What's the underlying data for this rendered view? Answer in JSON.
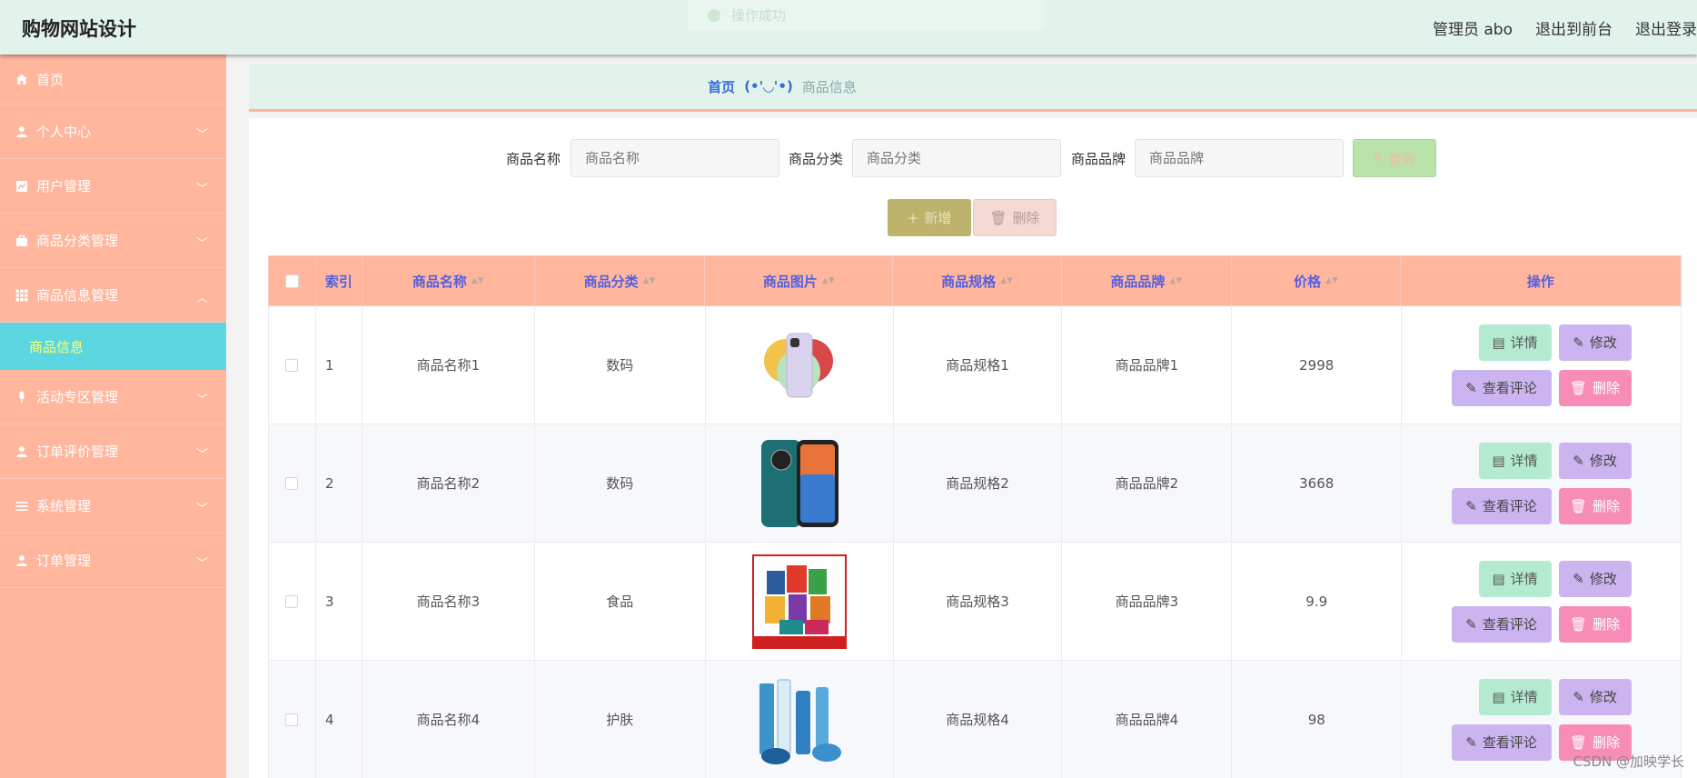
{
  "header": {
    "brand": "购物网站设计",
    "admin": "管理员 abo",
    "front": "退出到前台",
    "logout": "退出登录"
  },
  "toast": "操作成功",
  "sidebar": {
    "items": [
      {
        "label": "首页",
        "icon": "home-icon"
      },
      {
        "label": "个人中心",
        "icon": "user-icon"
      },
      {
        "label": "用户管理",
        "icon": "chart-icon"
      },
      {
        "label": "商品分类管理",
        "icon": "briefcase-icon"
      },
      {
        "label": "商品信息管理",
        "icon": "grid-icon"
      },
      {
        "label": "活动专区管理",
        "icon": "mic-icon"
      },
      {
        "label": "订单评价管理",
        "icon": "user-icon"
      },
      {
        "label": "系统管理",
        "icon": "list-icon"
      },
      {
        "label": "订单管理",
        "icon": "user-icon"
      }
    ],
    "sub_active": "商品信息"
  },
  "breadcrumb": {
    "home": "首页",
    "sep": "(•'◡'•)",
    "current": "商品信息"
  },
  "search": {
    "name_label": "商品名称",
    "name_placeholder": "商品名称",
    "category_label": "商品分类",
    "category_placeholder": "商品分类",
    "brand_label": "商品品牌",
    "brand_placeholder": "商品品牌",
    "query": "查询"
  },
  "actions": {
    "add": "新增",
    "delete": "删除"
  },
  "table": {
    "headers": [
      "索引",
      "商品名称",
      "商品分类",
      "商品图片",
      "商品规格",
      "商品品牌",
      "价格",
      "操作"
    ],
    "rows": [
      {
        "index": "1",
        "name": "商品名称1",
        "category": "数码",
        "spec": "商品规格1",
        "brand": "商品品牌1",
        "price": "2998"
      },
      {
        "index": "2",
        "name": "商品名称2",
        "category": "数码",
        "spec": "商品规格2",
        "brand": "商品品牌2",
        "price": "3668"
      },
      {
        "index": "3",
        "name": "商品名称3",
        "category": "食品",
        "spec": "商品规格3",
        "brand": "商品品牌3",
        "price": "9.9"
      },
      {
        "index": "4",
        "name": "商品名称4",
        "category": "护肤",
        "spec": "商品规格4",
        "brand": "商品品牌4",
        "price": "98"
      }
    ],
    "ops": {
      "detail": "详情",
      "edit": "修改",
      "comment": "查看评论",
      "remove": "删除"
    }
  },
  "watermark": "CSDN @加映学长"
}
